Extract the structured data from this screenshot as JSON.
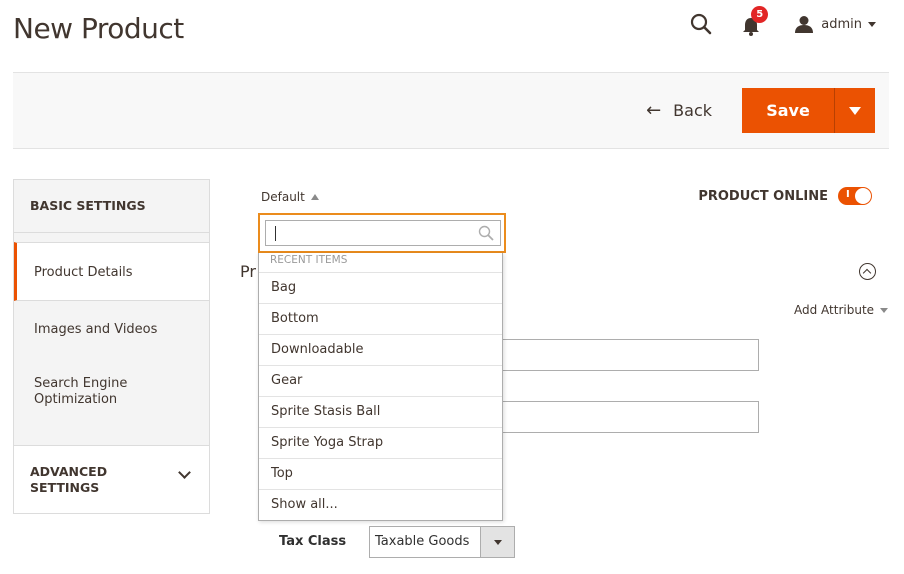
{
  "page": {
    "title": "New Product"
  },
  "header": {
    "notification_count": "5",
    "user_name": "admin"
  },
  "action_bar": {
    "back_label": "Back",
    "save_label": "Save"
  },
  "sidebar": {
    "basic_settings_label": "BASIC SETTINGS",
    "items": [
      {
        "label": "Product Details",
        "active": true
      },
      {
        "label": "Images and Videos",
        "active": false
      },
      {
        "label": "Search Engine Optimization",
        "active": false
      }
    ],
    "advanced_settings_label": "ADVANCED SETTINGS"
  },
  "form": {
    "scope_label": "Default",
    "product_online_label": "PRODUCT ONLINE",
    "product_online_state": "I",
    "section_title_partial": "Pr",
    "add_attribute_label": "Add Attribute",
    "tax_class_label": "Tax Class",
    "tax_class_value": "Taxable Goods"
  },
  "dropdown": {
    "search_value": "",
    "header": "RECENT ITEMS",
    "items": [
      "Bag",
      "Bottom",
      "Downloadable",
      "Gear",
      "Sprite Stasis Ball",
      "Sprite Yoga Strap",
      "Top",
      "Show all..."
    ]
  },
  "colors": {
    "accent": "#eb5202",
    "focus_border": "#eb8c1d",
    "badge": "#e22626"
  }
}
